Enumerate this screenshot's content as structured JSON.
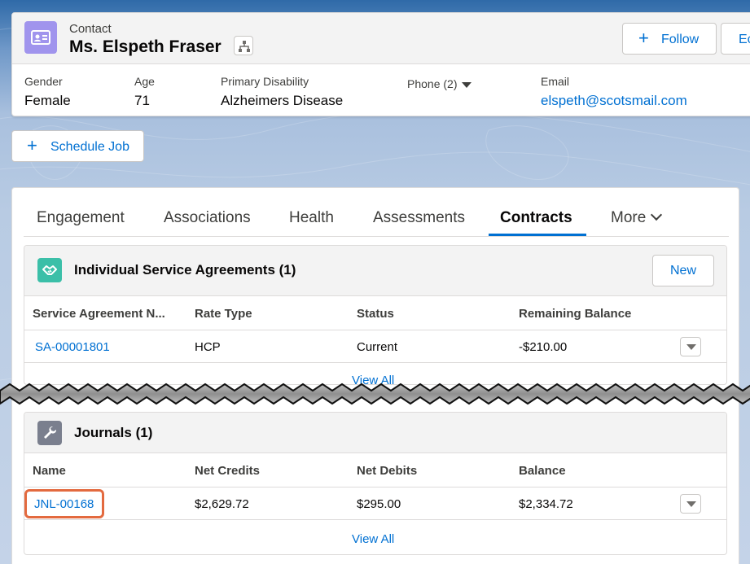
{
  "header": {
    "object_type": "Contact",
    "record_name": "Ms. Elspeth Fraser",
    "follow_label": "Follow",
    "edit_label": "Ec",
    "fields": [
      {
        "label": "Gender",
        "value": "Female"
      },
      {
        "label": "Age",
        "value": "71"
      },
      {
        "label": "Primary Disability",
        "value": "Alzheimers Disease"
      },
      {
        "label": "Email",
        "value": "elspeth@scotsmail.com"
      }
    ],
    "phone_label": "Phone (2)"
  },
  "actions": {
    "schedule_job_label": "Schedule Job"
  },
  "tabs": [
    {
      "label": "Engagement",
      "active": false
    },
    {
      "label": "Associations",
      "active": false
    },
    {
      "label": "Health",
      "active": false
    },
    {
      "label": "Assessments",
      "active": false
    },
    {
      "label": "Contracts",
      "active": true
    },
    {
      "label": "More",
      "active": false
    }
  ],
  "service_agreements": {
    "title": "Individual Service Agreements (1)",
    "new_label": "New",
    "columns": [
      "Service Agreement N...",
      "Rate Type",
      "Status",
      "Remaining Balance"
    ],
    "rows": [
      {
        "name": "SA-00001801",
        "rate_type": "HCP",
        "status": "Current",
        "remaining_balance": "-$210.00"
      }
    ],
    "view_all_label": "View All"
  },
  "journals": {
    "title": "Journals (1)",
    "columns": [
      "Name",
      "Net Credits",
      "Net Debits",
      "Balance"
    ],
    "rows": [
      {
        "name": "JNL-00168",
        "net_credits": "$2,629.72",
        "net_debits": "$295.00",
        "balance": "$2,334.72"
      }
    ],
    "view_all_label": "View All"
  },
  "colors": {
    "brand_blue": "#0070d2",
    "contact_icon": "#a094ed",
    "agreement_icon": "#3bbfa8",
    "journal_icon": "#7a7f8e",
    "highlight": "#e36a3f"
  }
}
